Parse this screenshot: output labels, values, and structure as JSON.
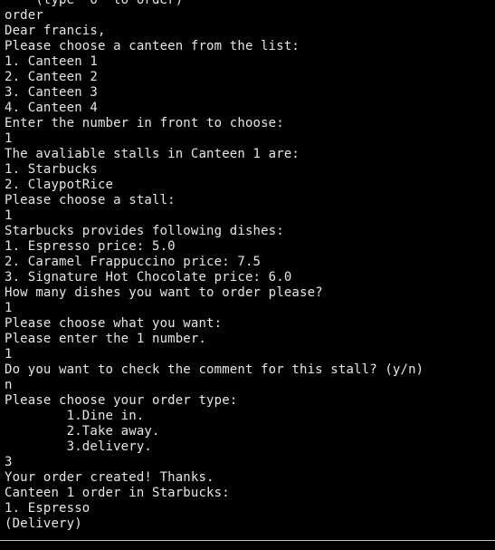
{
  "terminal": {
    "lines": [
      "    (type 'o' to order)",
      "order",
      "Dear francis,",
      "Please choose a canteen from the list:",
      "1. Canteen 1",
      "2. Canteen 2",
      "3. Canteen 3",
      "4. Canteen 4",
      "Enter the number in front to choose:",
      "1",
      "The avaliable stalls in Canteen 1 are:",
      "1. Starbucks",
      "2. ClaypotRice",
      "Please choose a stall:",
      "1",
      "Starbucks provides following dishes:",
      "1. Espresso price: 5.0",
      "2. Caramel Frappuccino price: 7.5",
      "3. Signature Hot Chocolate price: 6.0",
      "How many dishes you want to order please?",
      "1",
      "Please choose what you want:",
      "Please enter the 1 number.",
      "1",
      "Do you want to check the comment for this stall? (y/n)",
      "n",
      "Please choose your order type:",
      "        1.Dine in.",
      "        2.Take away.",
      "        3.delivery.",
      "3",
      "Your order created! Thanks.",
      "Canteen 1 order in Starbucks:",
      "1. Espresso",
      "(Delivery)"
    ]
  }
}
